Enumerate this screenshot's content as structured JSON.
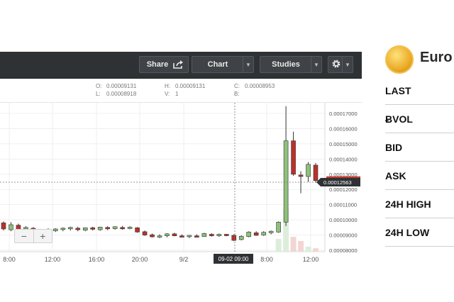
{
  "toolbar": {
    "share_label": "Share",
    "chart_label": "Chart",
    "studies_label": "Studies"
  },
  "ohlc": {
    "o_label": "O:",
    "o_value": "0.00009131",
    "h_label": "H:",
    "h_value": "0.00009131",
    "c_label": "C:",
    "c_value": "0.00008953",
    "l_label": "L:",
    "l_value": "0.00008918",
    "v_label": "V:",
    "v_value": "1",
    "b_label": "B:",
    "b_value": ""
  },
  "chart_data": {
    "type": "candlestick",
    "y_ticks": [
      "0.00017000",
      "0.00016000",
      "0.00015000",
      "0.00014000",
      "0.00013000",
      "0.00012000",
      "0.00011000",
      "0.00010000",
      "0.00009000",
      "0.00008000"
    ],
    "ylim": [
      7.9e-05,
      0.0001748
    ],
    "x_ticks": [
      "8:00",
      "12:00",
      "16:00",
      "20:00",
      "9/2",
      "8:00",
      "12:00"
    ],
    "crosshair_time": "09-02 09:00",
    "last_price": "0.00012563",
    "last_price_color": "#c0392b",
    "up_color": "#8fc07a",
    "down_color": "#b8322a",
    "candles": [
      {
        "o": 9.8e-05,
        "h": 9.9e-05,
        "l": 9.3e-05,
        "c": 9.4e-05
      },
      {
        "o": 9.35e-05,
        "h": 9.85e-05,
        "l": 9.25e-05,
        "c": 9.68e-05
      },
      {
        "o": 9.65e-05,
        "h": 9.75e-05,
        "l": 9.2e-05,
        "c": 9.35e-05
      },
      {
        "o": 9.4e-05,
        "h": 9.58e-05,
        "l": 9.25e-05,
        "c": 9.5e-05
      },
      {
        "o": 9.45e-05,
        "h": 9.52e-05,
        "l": 9.2e-05,
        "c": 9.3e-05
      },
      {
        "o": 9.25e-05,
        "h": 9.4e-05,
        "l": 9.15e-05,
        "c": 9.35e-05
      },
      {
        "o": 9.35e-05,
        "h": 9.45e-05,
        "l": 9.2e-05,
        "c": 9.25e-05
      },
      {
        "o": 9.28e-05,
        "h": 9.45e-05,
        "l": 9.2e-05,
        "c": 9.4e-05
      },
      {
        "o": 9.38e-05,
        "h": 9.5e-05,
        "l": 9.25e-05,
        "c": 9.45e-05
      },
      {
        "o": 9.42e-05,
        "h": 9.55e-05,
        "l": 9.3e-05,
        "c": 9.5e-05
      },
      {
        "o": 9.45e-05,
        "h": 9.55e-05,
        "l": 9.25e-05,
        "c": 9.35e-05
      },
      {
        "o": 9.32e-05,
        "h": 9.5e-05,
        "l": 9.25e-05,
        "c": 9.48e-05
      },
      {
        "o": 9.48e-05,
        "h": 9.55e-05,
        "l": 9.3e-05,
        "c": 9.38e-05
      },
      {
        "o": 9.35e-05,
        "h": 9.55e-05,
        "l": 9.28e-05,
        "c": 9.52e-05
      },
      {
        "o": 9.5e-05,
        "h": 9.58e-05,
        "l": 9.32e-05,
        "c": 9.42e-05
      },
      {
        "o": 9.42e-05,
        "h": 9.58e-05,
        "l": 9.35e-05,
        "c": 9.55e-05
      },
      {
        "o": 9.5e-05,
        "h": 9.6e-05,
        "l": 9.35e-05,
        "c": 9.45e-05
      },
      {
        "o": 9.45e-05,
        "h": 9.58e-05,
        "l": 9.38e-05,
        "c": 9.52e-05
      },
      {
        "o": 9.48e-05,
        "h": 9.52e-05,
        "l": 9.15e-05,
        "c": 9.2e-05
      },
      {
        "o": 9.22e-05,
        "h": 9.3e-05,
        "l": 8.95e-05,
        "c": 9e-05
      },
      {
        "o": 9.02e-05,
        "h": 9.1e-05,
        "l": 8.85e-05,
        "c": 8.88e-05
      },
      {
        "o": 8.88e-05,
        "h": 9.05e-05,
        "l": 8.8e-05,
        "c": 8.95e-05
      },
      {
        "o": 8.95e-05,
        "h": 9.12e-05,
        "l": 8.85e-05,
        "c": 9.08e-05
      },
      {
        "o": 9.08e-05,
        "h": 9.15e-05,
        "l": 8.92e-05,
        "c": 8.95e-05
      },
      {
        "o": 8.95e-05,
        "h": 9.05e-05,
        "l": 8.85e-05,
        "c": 8.9e-05
      },
      {
        "o": 8.9e-05,
        "h": 9e-05,
        "l": 8.8e-05,
        "c": 8.98e-05
      },
      {
        "o": 8.95e-05,
        "h": 9.05e-05,
        "l": 8.85e-05,
        "c": 8.9e-05
      },
      {
        "o": 8.9e-05,
        "h": 9.15e-05,
        "l": 8.88e-05,
        "c": 9.1e-05
      },
      {
        "o": 9.05e-05,
        "h": 9.12e-05,
        "l": 8.9e-05,
        "c": 8.95e-05
      },
      {
        "o": 8.95e-05,
        "h": 9.1e-05,
        "l": 8.88e-05,
        "c": 9.05e-05
      },
      {
        "o": 9.05e-05,
        "h": 9.08e-05,
        "l": 8.92e-05,
        "c": 8.98e-05
      },
      {
        "o": 8.98e-05,
        "h": 9.05e-05,
        "l": 8.6e-05,
        "c": 8.65e-05
      },
      {
        "o": 8.7e-05,
        "h": 8.98e-05,
        "l": 8.65e-05,
        "c": 8.92e-05
      },
      {
        "o": 8.9e-05,
        "h": 9.25e-05,
        "l": 8.85e-05,
        "c": 9.2e-05
      },
      {
        "o": 9.15e-05,
        "h": 9.25e-05,
        "l": 8.95e-05,
        "c": 8.98e-05
      },
      {
        "o": 9e-05,
        "h": 9.25e-05,
        "l": 8.95e-05,
        "c": 9.18e-05
      },
      {
        "o": 9.15e-05,
        "h": 9.3e-05,
        "l": 9.05e-05,
        "c": 9.25e-05
      },
      {
        "o": 9.2e-05,
        "h": 9.9e-05,
        "l": 9.15e-05,
        "c": 9.85e-05
      },
      {
        "o": 9.85e-05,
        "h": 0.0001748,
        "l": 9.6e-05,
        "c": 0.000152
      },
      {
        "o": 0.000152,
        "h": 0.000158,
        "l": 0.000129,
        "c": 0.00013
      },
      {
        "o": 0.0001295,
        "h": 0.000132,
        "l": 0.0001175,
        "c": 0.0001285
      },
      {
        "o": 0.0001285,
        "h": 0.000138,
        "l": 0.000125,
        "c": 0.0001365
      },
      {
        "o": 0.000136,
        "h": 0.0001375,
        "l": 0.0001245,
        "c": 0.0001258
      }
    ],
    "volumes": [
      0,
      0,
      0,
      0,
      0,
      0,
      0,
      0,
      0,
      0,
      0,
      0,
      0,
      0,
      0,
      0,
      0,
      0,
      0,
      0,
      0,
      0,
      0,
      0,
      0,
      0,
      0,
      0,
      0,
      0,
      0,
      0,
      0,
      0,
      0,
      0,
      0,
      0.3,
      1.0,
      0.35,
      0.25,
      0.12,
      0.08
    ]
  },
  "sidebar": {
    "title": "Euro",
    "stats": [
      "LAST",
      "ɃVOL",
      "BID",
      "ASK",
      "24H HIGH",
      "24H LOW"
    ]
  }
}
